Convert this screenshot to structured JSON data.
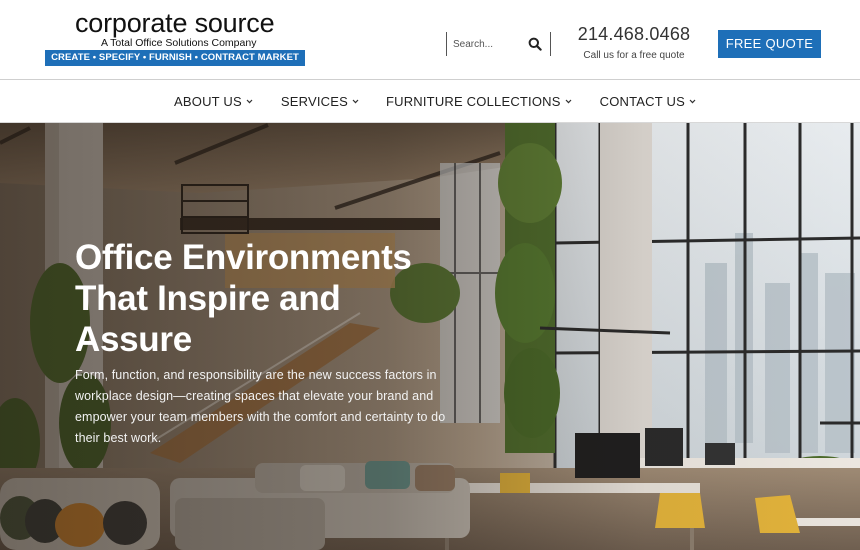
{
  "header": {
    "logo": {
      "name": "corporate source",
      "tagline": "A Total Office Solutions Company",
      "strip": "CREATE • SPECIFY • FURNISH • CONTRACT MARKET"
    },
    "search": {
      "placeholder": "Search...",
      "icon": "search-icon"
    },
    "phone": {
      "number": "214.468.0468",
      "subtitle": "Call us for a free quote"
    },
    "cta_label": "FREE QUOTE",
    "colors": {
      "brand_blue": "#1e6fb8"
    }
  },
  "nav": {
    "items": [
      {
        "label": "ABOUT US",
        "icon": "chevron-down-icon"
      },
      {
        "label": "SERVICES",
        "icon": "chevron-down-icon"
      },
      {
        "label": "FURNITURE COLLECTIONS",
        "icon": "chevron-down-icon"
      },
      {
        "label": "CONTACT US",
        "icon": "chevron-down-icon"
      }
    ]
  },
  "hero": {
    "title": "Office Environments That Inspire and Assure",
    "body": "Form, function, and responsibility are the new success factors in workplace design—creating spaces that elevate your brand and empower your team members with the comfort and certainty to do their best work."
  }
}
